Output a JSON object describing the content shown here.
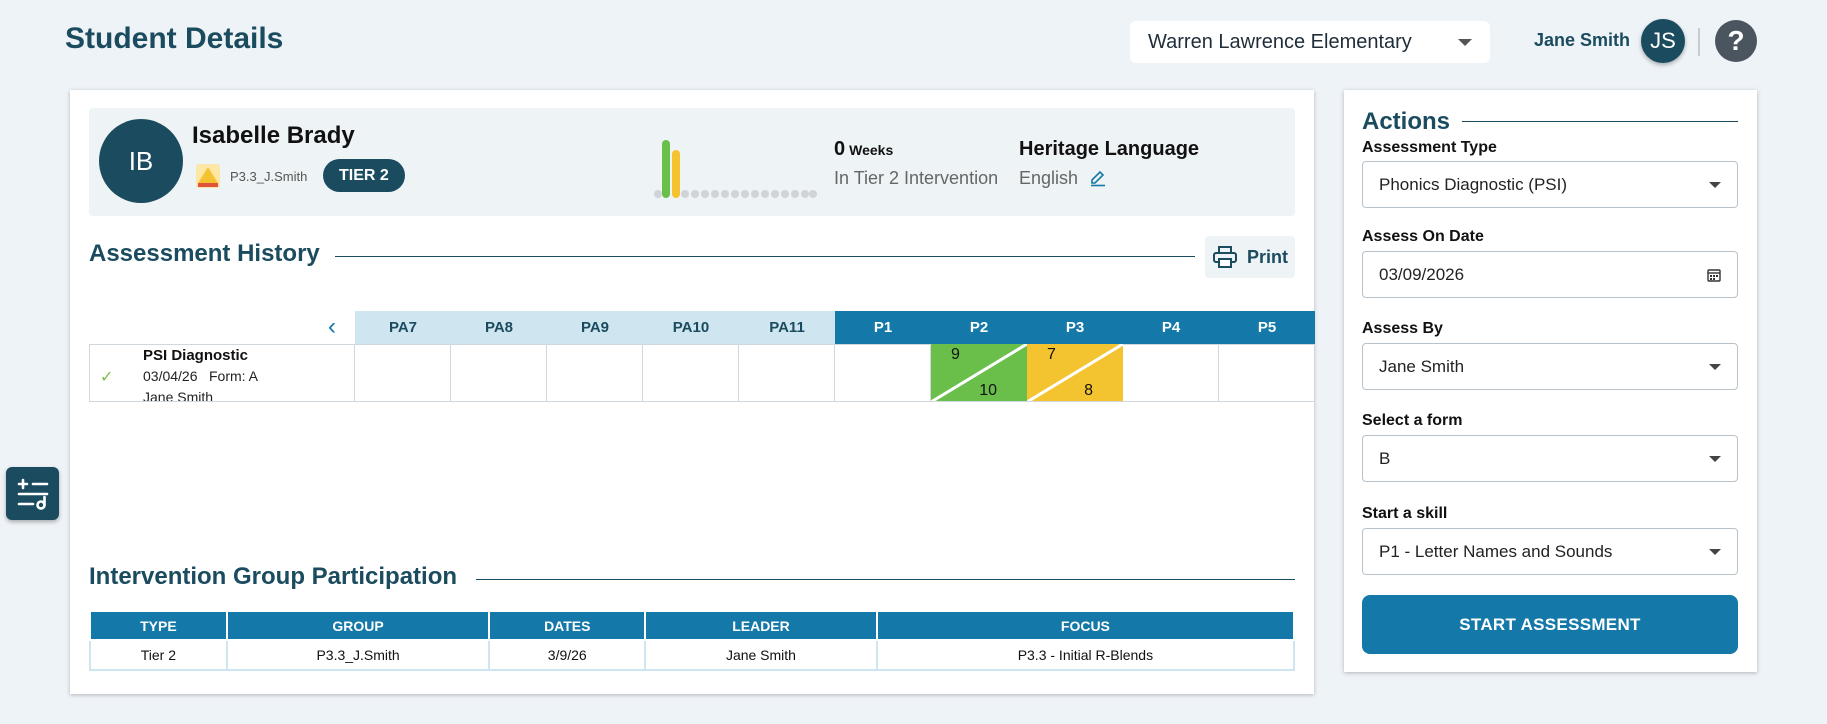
{
  "header": {
    "title": "Student Details",
    "school": "Warren Lawrence Elementary",
    "user_name": "Jane Smith",
    "user_initials": "JS",
    "help": "?"
  },
  "student": {
    "initials": "IB",
    "name": "Isabelle Brady",
    "group_code": "P3.3_J.Smith",
    "tier": "TIER 2",
    "weeks_value": "0",
    "weeks_unit": "Weeks",
    "weeks_caption": "In Tier 2 Intervention",
    "heritage_label": "Heritage Language",
    "heritage_value": "English"
  },
  "assessment_history": {
    "title": "Assessment History",
    "print_label": "Print",
    "skills": [
      {
        "label": "PA7",
        "kind": "pa"
      },
      {
        "label": "PA8",
        "kind": "pa"
      },
      {
        "label": "PA9",
        "kind": "pa"
      },
      {
        "label": "PA10",
        "kind": "pa"
      },
      {
        "label": "PA11",
        "kind": "pa"
      },
      {
        "label": "P1",
        "kind": "p"
      },
      {
        "label": "P2",
        "kind": "p"
      },
      {
        "label": "P3",
        "kind": "p"
      },
      {
        "label": "P4",
        "kind": "p"
      },
      {
        "label": "P5",
        "kind": "p"
      }
    ],
    "rows": [
      {
        "title": "PSI Diagnostic",
        "date": "03/04/26",
        "form": "Form: A",
        "by": "Jane Smith",
        "scores": [
          {
            "skill": "P2",
            "top": "9",
            "bottom": "10",
            "color": "#6abf4b"
          },
          {
            "skill": "P3",
            "top": "7",
            "bottom": "8",
            "color": "#f4c430"
          }
        ]
      }
    ]
  },
  "intervention": {
    "title": "Intervention Group Participation",
    "columns": [
      "TYPE",
      "GROUP",
      "DATES",
      "LEADER",
      "FOCUS"
    ],
    "rows": [
      [
        "Tier 2",
        "P3.3_J.Smith",
        "3/9/26",
        "Jane Smith",
        "P3.3 - Initial R-Blends"
      ]
    ]
  },
  "actions": {
    "title": "Actions",
    "assessment_type_label": "Assessment Type",
    "assessment_type_value": "Phonics Diagnostic (PSI)",
    "assess_on_label": "Assess On Date",
    "assess_on_value": "03/09/2026",
    "assess_by_label": "Assess By",
    "assess_by_value": "Jane Smith",
    "form_label": "Select a form",
    "form_value": "B",
    "skill_label": "Start a skill",
    "skill_value": "P1 - Letter Names and Sounds",
    "start_button": "START ASSESSMENT"
  },
  "colors": {
    "brand_dark": "#1b4b5e",
    "brand_blue": "#1478a8",
    "score_green": "#6abf4b",
    "score_yellow": "#f4c430"
  }
}
